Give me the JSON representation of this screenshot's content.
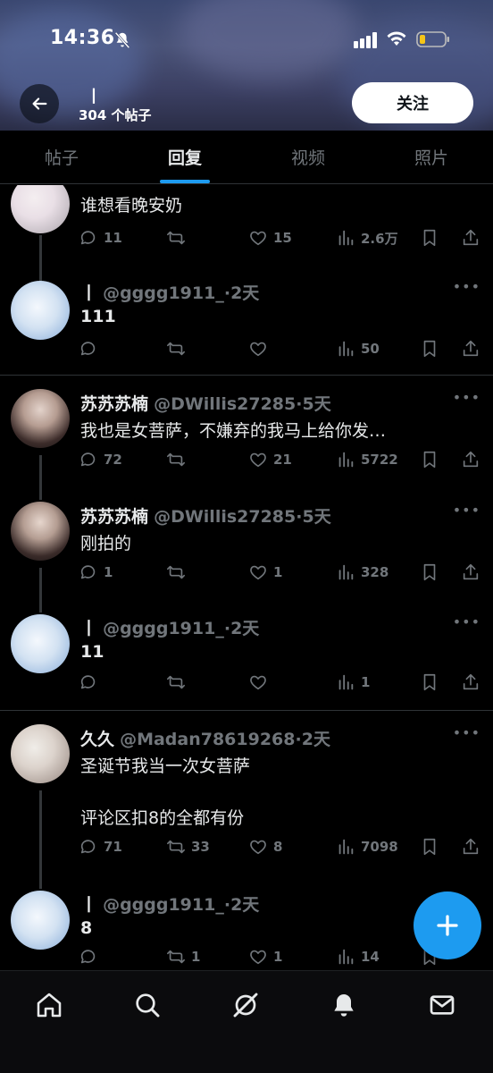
{
  "status_bar": {
    "time": "14:36"
  },
  "header": {
    "profile_name": "丨",
    "post_count": "304 个帖子",
    "follow_label": "关注"
  },
  "tabs": [
    {
      "label": "帖子",
      "active": false
    },
    {
      "label": "回复",
      "active": true
    },
    {
      "label": "视频",
      "active": false
    },
    {
      "label": "照片",
      "active": false
    }
  ],
  "posts": [
    {
      "name": "",
      "handle": "",
      "time": "",
      "text": "谁想看晚安奶",
      "replies": "11",
      "reposts": "",
      "likes": "15",
      "views": "2.6万"
    },
    {
      "name": "丨",
      "handle": "@gggg1911_",
      "time": "·2天",
      "text": "111",
      "replies": "",
      "reposts": "",
      "likes": "",
      "views": "50"
    },
    {
      "name": "苏苏苏楠",
      "handle": "@DWillis27285",
      "time": "·5天",
      "text": "我也是女菩萨，不嫌弃的我马上给你发…",
      "replies": "72",
      "reposts": "",
      "likes": "21",
      "views": "5722"
    },
    {
      "name": "苏苏苏楠",
      "handle": "@DWillis27285",
      "time": "·5天",
      "text": "刚拍的",
      "replies": "1",
      "reposts": "",
      "likes": "1",
      "views": "328"
    },
    {
      "name": "丨",
      "handle": "@gggg1911_",
      "time": "·2天",
      "text": "11",
      "replies": "",
      "reposts": "",
      "likes": "",
      "views": "1"
    },
    {
      "name": "久久",
      "handle": "@Madan78619268",
      "time": "·2天",
      "text": "圣诞节我当一次女菩萨",
      "text2": "评论区扣8的全都有份",
      "replies": "71",
      "reposts": "33",
      "likes": "8",
      "views": "7098"
    },
    {
      "name": "丨",
      "handle": "@gggg1911_",
      "time": "·2天",
      "text": "8",
      "replies": "",
      "reposts": "1",
      "likes": "1",
      "views": "14"
    }
  ],
  "colors": {
    "background": "#000000",
    "accent": "#1d9bf0",
    "muted": "#71767b",
    "text": "#e7e9ea"
  },
  "icons": {
    "nav": [
      "home-icon",
      "search-icon",
      "grok-icon",
      "notifications-icon",
      "messages-icon"
    ]
  }
}
